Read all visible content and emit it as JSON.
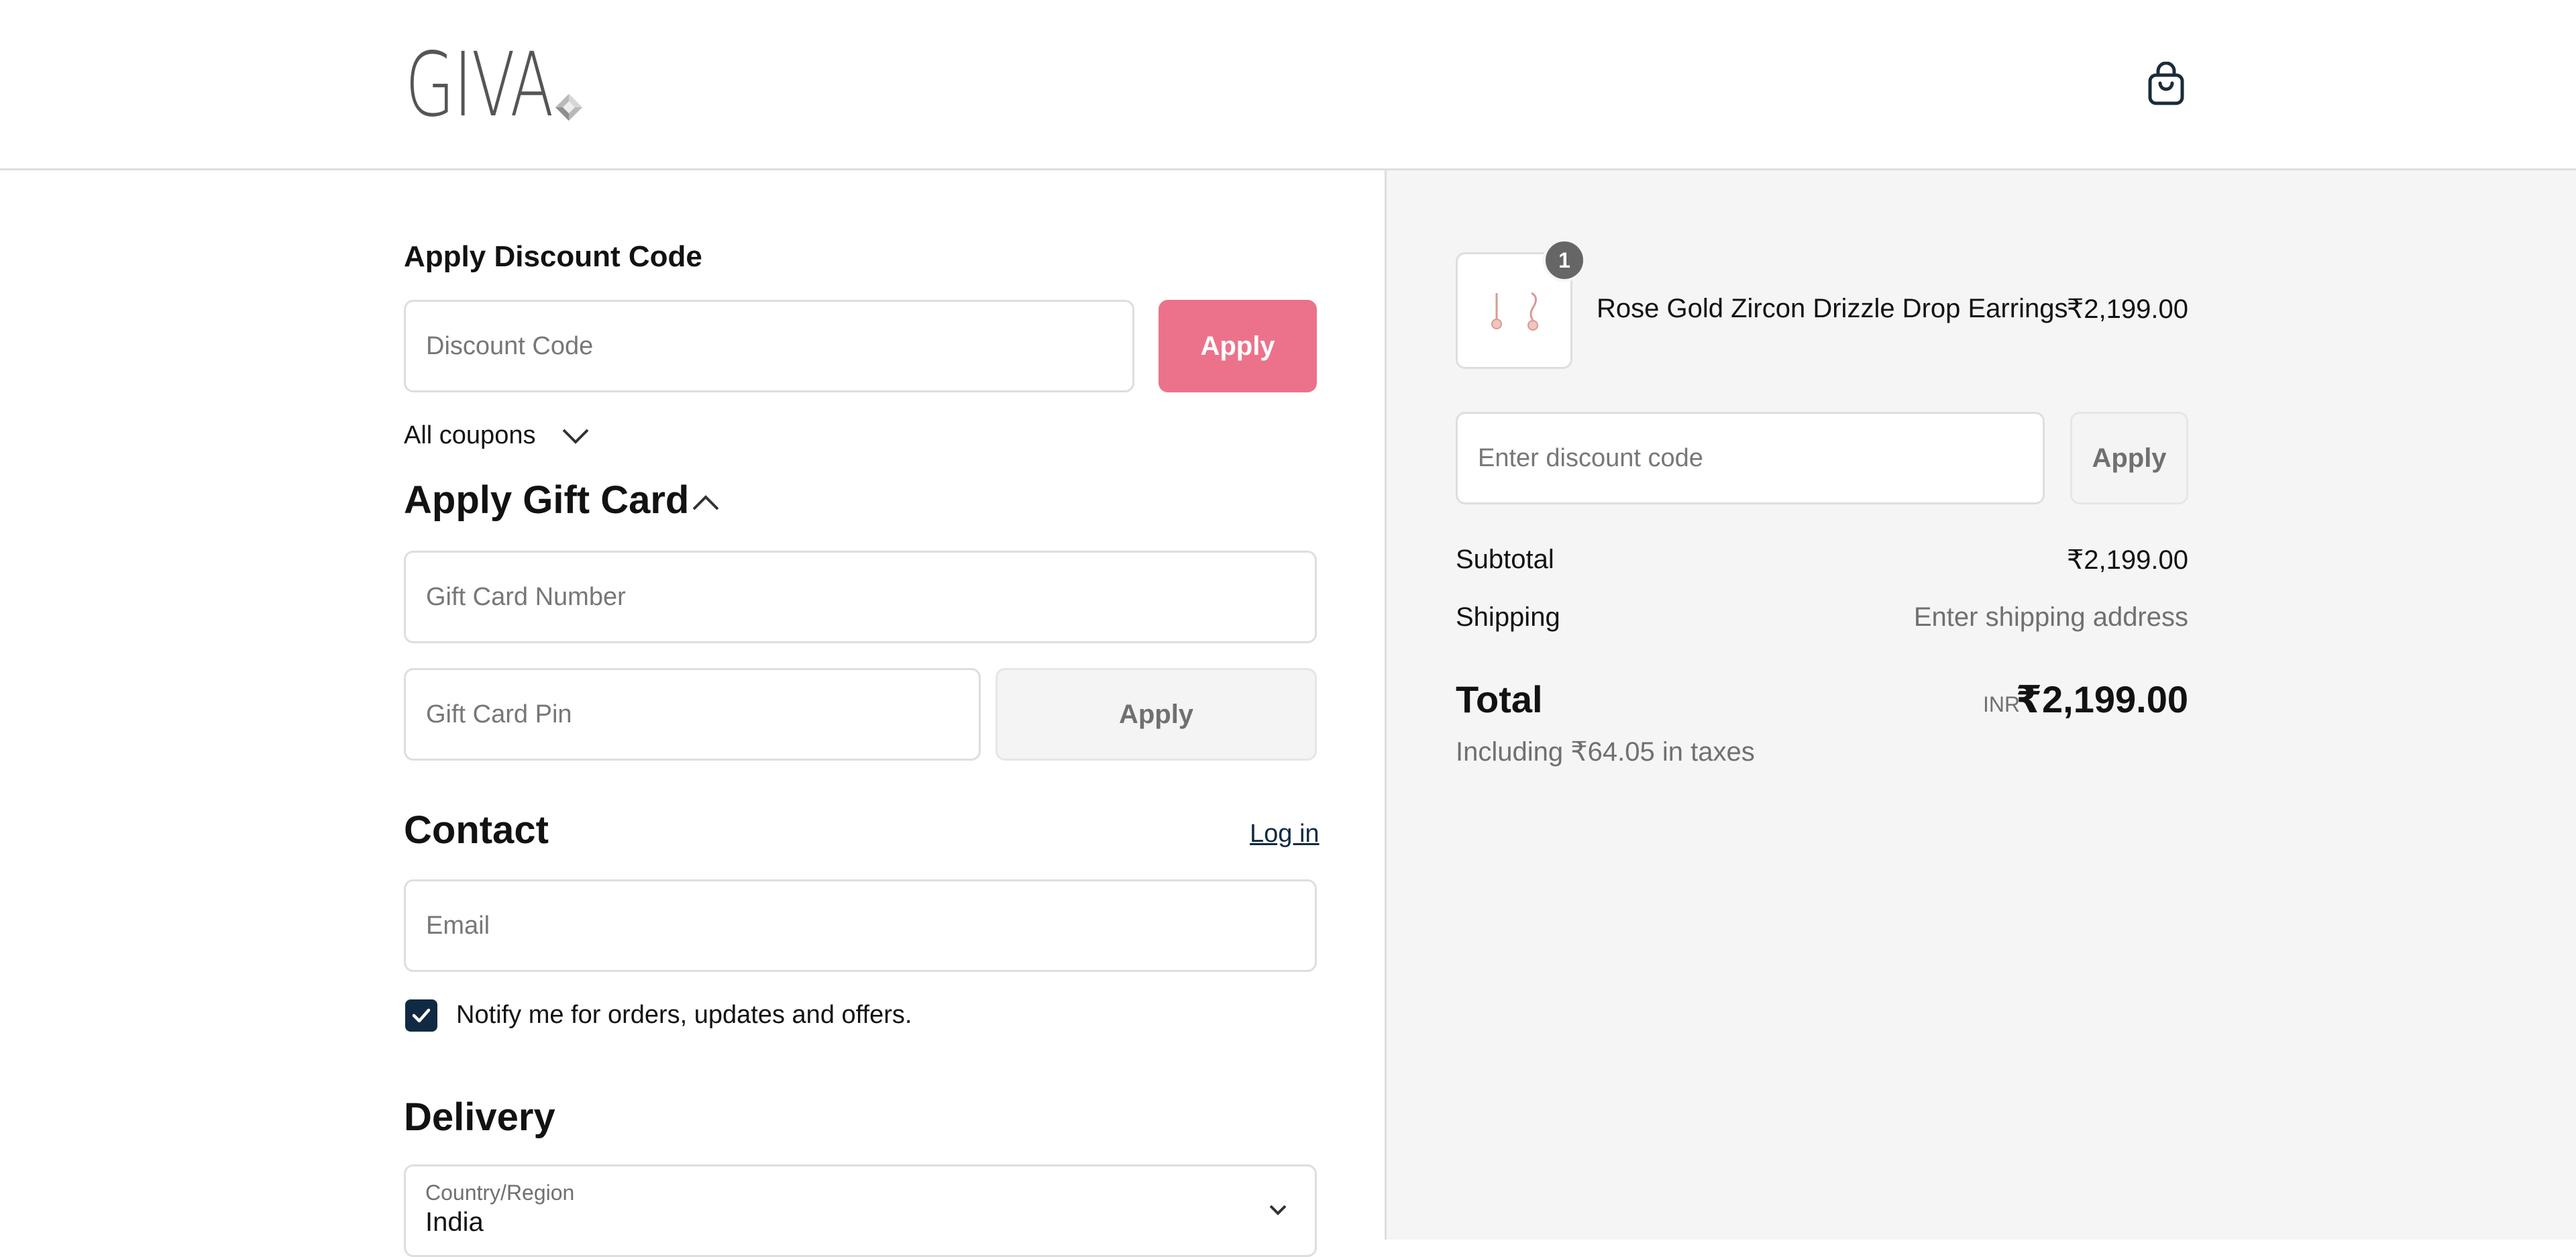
{
  "header": {
    "logo_text": "GIVA",
    "cart_icon": "shopping-bag-icon"
  },
  "discount": {
    "heading": "Apply Discount Code",
    "placeholder": "Discount Code",
    "apply_label": "Apply",
    "all_coupons_label": "All coupons"
  },
  "gift_card": {
    "heading": "Apply Gift Card",
    "number_placeholder": "Gift Card Number",
    "pin_placeholder": "Gift Card Pin",
    "apply_label": "Apply"
  },
  "contact": {
    "heading": "Contact",
    "login_label": "Log in",
    "email_placeholder": "Email",
    "notify_label": "Notify me for orders, updates and offers.",
    "notify_checked": true
  },
  "delivery": {
    "heading": "Delivery",
    "country_label": "Country/Region",
    "country_value": "India"
  },
  "summary": {
    "item": {
      "name": "Rose Gold Zircon Drizzle Drop Earrings",
      "price": "₹2,199.00",
      "quantity": "1"
    },
    "discount_placeholder": "Enter discount code",
    "apply_label": "Apply",
    "subtotal_label": "Subtotal",
    "subtotal_value": "₹2,199.00",
    "shipping_label": "Shipping",
    "shipping_value": "Enter shipping address",
    "total_label": "Total",
    "currency": "INR",
    "total_value": "₹2,199.00",
    "taxes_note": "Including ₹64.05 in taxes"
  },
  "colors": {
    "accent": "#ec728b",
    "checkbox": "#102a43",
    "summary_bg": "#f5f5f5"
  }
}
